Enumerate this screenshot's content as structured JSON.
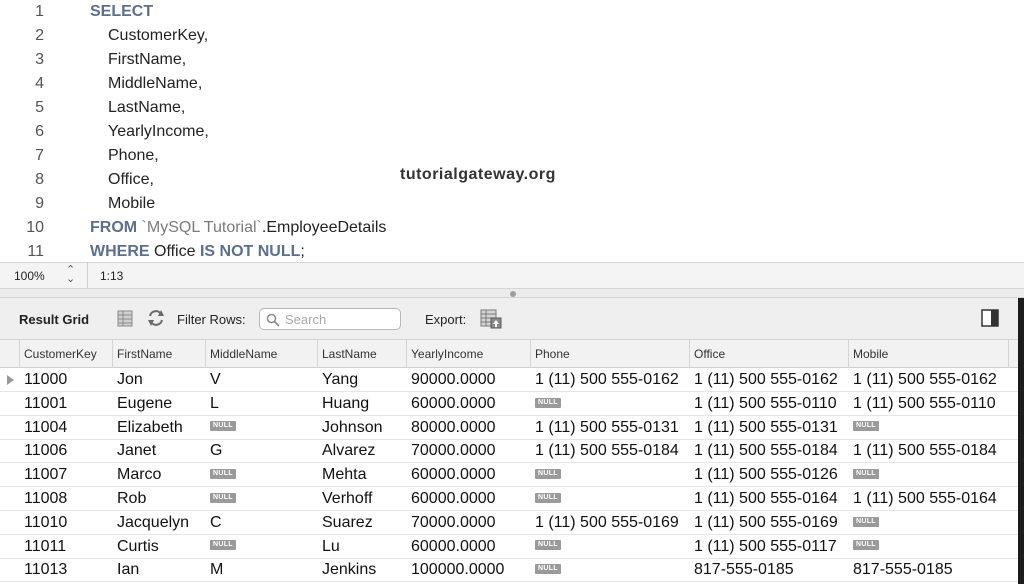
{
  "editor": {
    "line_numbers": [
      "1",
      "2",
      "3",
      "4",
      "5",
      "6",
      "7",
      "8",
      "9",
      "10",
      "11"
    ],
    "lines": {
      "l1_kw": "SELECT",
      "l2": "CustomerKey,",
      "l3": "FirstName,",
      "l4": "MiddleName,",
      "l5": "LastName,",
      "l6": "YearlyIncome,",
      "l7": "Phone,",
      "l8": "Office,",
      "l9": "Mobile",
      "l10_kw": "FROM",
      "l10_str": " `MySQL Tutorial`",
      "l10_rest": ".EmployeeDetails",
      "l11_kw1": "WHERE",
      "l11_mid": " Office ",
      "l11_kw2": "IS NOT NULL",
      "l11_end": ";"
    },
    "watermark": "tutorialgateway.org"
  },
  "status_bar": {
    "zoom": "100%",
    "zoom_stepper_up": "⌃",
    "zoom_stepper_down": "⌄",
    "cursor_position": "1:13"
  },
  "toolbar": {
    "result_grid_label": "Result Grid",
    "filter_rows_label": "Filter Rows:",
    "search_placeholder": "Search",
    "export_label": "Export:"
  },
  "grid": {
    "columns": [
      "CustomerKey",
      "FirstName",
      "MiddleName",
      "LastName",
      "YearlyIncome",
      "Phone",
      "Office",
      "Mobile"
    ],
    "null_label": "NULL",
    "rows": [
      [
        "11000",
        "Jon",
        "V",
        "Yang",
        "90000.0000",
        "1 (11) 500 555-0162",
        "1 (11) 500 555-0162",
        "1 (11) 500 555-0162"
      ],
      [
        "11001",
        "Eugene",
        "L",
        "Huang",
        "60000.0000",
        null,
        "1 (11) 500 555-0110",
        "1 (11) 500 555-0110"
      ],
      [
        "11004",
        "Elizabeth",
        null,
        "Johnson",
        "80000.0000",
        "1 (11) 500 555-0131",
        "1 (11) 500 555-0131",
        null
      ],
      [
        "11006",
        "Janet",
        "G",
        "Alvarez",
        "70000.0000",
        "1 (11) 500 555-0184",
        "1 (11) 500 555-0184",
        "1 (11) 500 555-0184"
      ],
      [
        "11007",
        "Marco",
        null,
        "Mehta",
        "60000.0000",
        null,
        "1 (11) 500 555-0126",
        null
      ],
      [
        "11008",
        "Rob",
        null,
        "Verhoff",
        "60000.0000",
        null,
        "1 (11) 500 555-0164",
        "1 (11) 500 555-0164"
      ],
      [
        "11010",
        "Jacquelyn",
        "C",
        "Suarez",
        "70000.0000",
        "1 (11) 500 555-0169",
        "1 (11) 500 555-0169",
        null
      ],
      [
        "11011",
        "Curtis",
        null,
        "Lu",
        "60000.0000",
        null,
        "1 (11) 500 555-0117",
        null
      ],
      [
        "11013",
        "Ian",
        "M",
        "Jenkins",
        "100000.0000",
        null,
        "817-555-0185",
        "817-555-0185"
      ]
    ]
  }
}
